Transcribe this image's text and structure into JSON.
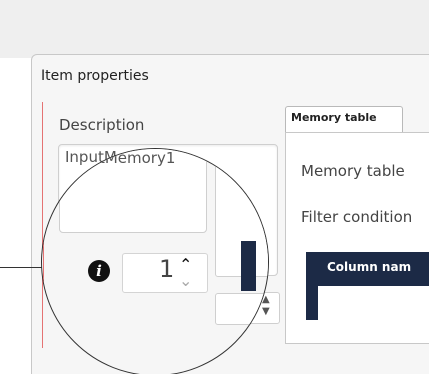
{
  "panel": {
    "title": "Item properties",
    "description_label": "Description",
    "description_value": "InputMemory1"
  },
  "tabs": [
    {
      "label": "Memory table"
    }
  ],
  "memory_tab": {
    "memory_table_label": "Memory table",
    "filter_label": "Filter condition",
    "column_header": "Column nam"
  },
  "number_field": {
    "value": "1",
    "up_icon": "spin-up-arrow",
    "down_icon": "spin-down-arrow"
  },
  "icons": {
    "info": "info-circle-icon",
    "info_glyph": "i"
  },
  "colors": {
    "accent_navy": "#1c2a46",
    "required_marker_red": "#e57373"
  }
}
